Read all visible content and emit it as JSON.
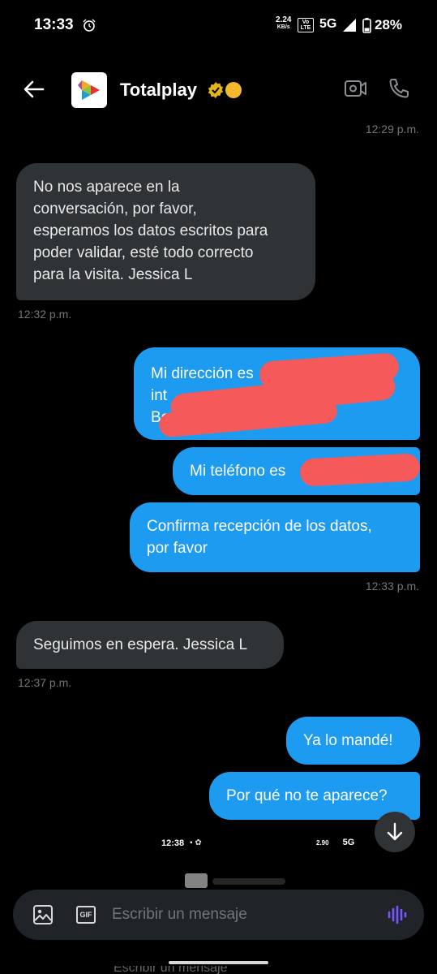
{
  "status_bar": {
    "time": "13:33",
    "speed_top": "2.24",
    "speed_unit": "KB/s",
    "volte_top": "Vo",
    "volte_bottom": "LTE",
    "network": "5G",
    "battery": "28%"
  },
  "header": {
    "title": "Totalplay",
    "verified_color": "#e2b719"
  },
  "messages": [
    {
      "type": "timestamp",
      "side": "right",
      "text": "12:29 p.m."
    },
    {
      "type": "in",
      "lines": [
        "No nos aparece en la",
        "conversación, por favor,",
        "esperamos los datos escritos para",
        "poder validar, esté todo correcto",
        "para la visita. Jessica L"
      ]
    },
    {
      "type": "timestamp",
      "side": "left",
      "text": "12:32 p.m."
    },
    {
      "type": "out",
      "lines": [
        "Mi dirección es",
        "int",
        "Benito"
      ]
    },
    {
      "type": "out",
      "lines": [
        "Mi teléfono es"
      ]
    },
    {
      "type": "out",
      "lines": [
        "Confirma recepción de los datos,",
        "por favor"
      ]
    },
    {
      "type": "timestamp",
      "side": "right",
      "text": "12:33 p.m."
    },
    {
      "type": "in",
      "lines": [
        "Seguimos en espera. Jessica L"
      ]
    },
    {
      "type": "timestamp",
      "side": "left",
      "text": "12:37 p.m."
    },
    {
      "type": "out",
      "lines": [
        "Ya lo mandé!"
      ]
    },
    {
      "type": "out",
      "lines": [
        "Por qué no te aparece?"
      ]
    }
  ],
  "ghost": {
    "time": "12:38",
    "network": "5G",
    "speed": "2.90"
  },
  "composer": {
    "placeholder": "Escribir un mensaje",
    "gif_label": "GIF"
  },
  "colors": {
    "accent": "#1d9bf0",
    "incoming_bubble": "#2f3336",
    "redaction": "#f5595a",
    "voice": "#7856ff"
  }
}
